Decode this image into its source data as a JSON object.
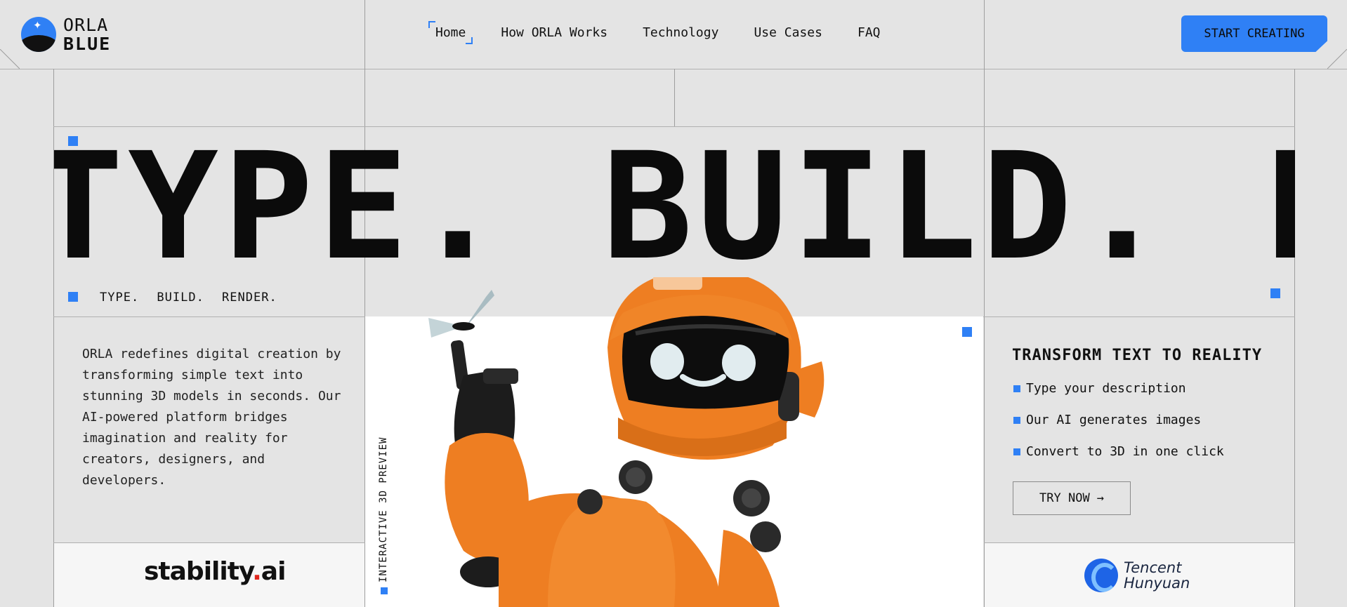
{
  "brand": {
    "line1": "ORLA",
    "line2": "BLUE",
    "star_icon": "sparkle-icon"
  },
  "nav": {
    "items": [
      {
        "label": "Home",
        "active": true
      },
      {
        "label": "How ORLA Works"
      },
      {
        "label": "Technology"
      },
      {
        "label": "Use Cases"
      },
      {
        "label": "FAQ"
      }
    ],
    "cta_label": "START CREATING"
  },
  "hero": {
    "marquee": "TYPE. BUILD. RENDER.",
    "tagline": "TYPE. BUILD. RENDER."
  },
  "description": "ORLA redefines digital creation by transforming simple text into stunning 3D models in seconds. Our AI-powered platform bridges imagination and reality for creators, designers, and developers.",
  "preview": {
    "vertical_label": "INTERACTIVE 3D PREVIEW"
  },
  "right_panel": {
    "title": "TRANSFORM TEXT TO REALITY",
    "steps": [
      "Type your description",
      "Our AI generates images",
      "Convert to 3D in one click"
    ],
    "try_label": "TRY NOW",
    "try_icon": "arrow-right-icon"
  },
  "partners": {
    "left": {
      "name": "stability",
      "dot": ".",
      "suffix": "ai"
    },
    "right": {
      "line1": "Tencent",
      "line2": "Hunyuan"
    }
  },
  "colors": {
    "accent": "#2f80f5",
    "background": "#e4e4e4",
    "robot": "#ee7e22"
  }
}
